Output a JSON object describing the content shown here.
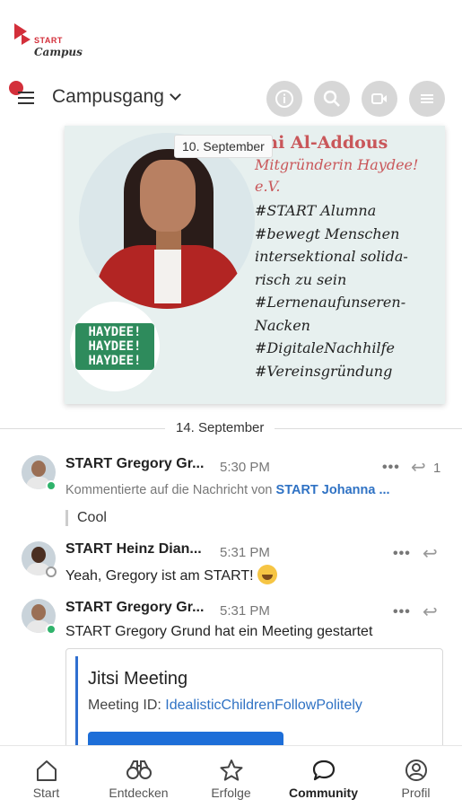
{
  "app": {
    "logo_line1": "START",
    "logo_line2": "Campus"
  },
  "header": {
    "channel_name": "Campusgang"
  },
  "post": {
    "date_tooltip": "10. September",
    "name": "ani Al-Addous",
    "role": "Mitgründerin Haydee! e.V.",
    "tags": "#START Alumna\n#bewegt Menschen intersektional solida-risch zu sein\n#Lernenaufunseren-Nacken\n#DigitaleNachhilfe\n#Vereinsgründung",
    "logo_text": "HAYDEE!\nHAYDEE!\nHAYDEE!"
  },
  "date_divider": "14. September",
  "messages": [
    {
      "sender": "START Gregory Gr...",
      "time": "5:30 PM",
      "more": "•••",
      "reply_count": "1",
      "system_prefix": "Kommentierte auf die Nachricht von ",
      "system_link": "START Johanna ...",
      "quote": "Cool",
      "status": "online"
    },
    {
      "sender": "START Heinz Dian...",
      "time": "5:31 PM",
      "more": "•••",
      "text": "Yeah, Gregory ist am START!",
      "status": "away"
    },
    {
      "sender": "START Gregory Gr...",
      "time": "5:31 PM",
      "more": "•••",
      "text": "START Gregory Grund hat ein Meeting gestartet",
      "status": "online",
      "card": {
        "title": "Jitsi Meeting",
        "id_label": "Meeting ID: ",
        "id_value": "IdealisticChildrenFollowPolitely"
      }
    }
  ],
  "bottom_nav": [
    {
      "label": "Start",
      "icon": "home-icon"
    },
    {
      "label": "Entdecken",
      "icon": "binoculars-icon"
    },
    {
      "label": "Erfolge",
      "icon": "star-icon"
    },
    {
      "label": "Community",
      "icon": "chat-bubble-icon",
      "active": true
    },
    {
      "label": "Profil",
      "icon": "profile-icon"
    }
  ],
  "colors": {
    "brand_red": "#d32f3a",
    "link_blue": "#2f72c4",
    "online_green": "#2fb36b",
    "button_blue": "#1d6ed8"
  }
}
